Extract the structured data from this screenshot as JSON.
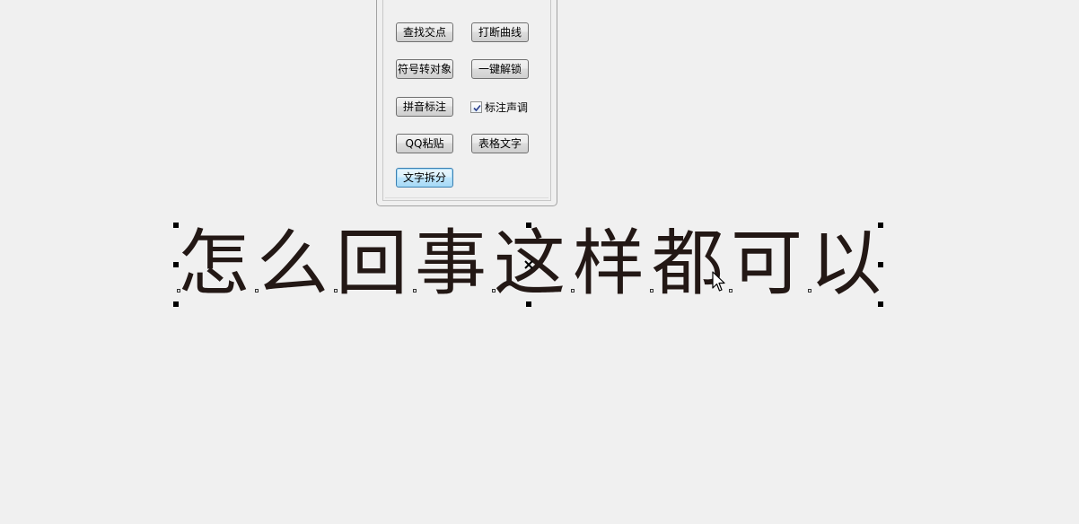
{
  "panel": {
    "buttons": {
      "find_intersection": "查找交点",
      "break_curve": "打断曲线",
      "symbol_to_object": "符号转对象",
      "one_click_unlock": "一键解锁",
      "pinyin_annotate": "拼音标注",
      "qq_paste": "QQ粘贴",
      "table_text": "表格文字",
      "text_split": "文字拆分"
    },
    "tone_checkbox": {
      "label": "标注声调",
      "checked": true
    }
  },
  "canvas": {
    "text": "怎么回事这样都可以",
    "text_color": "#231815"
  },
  "colors": {
    "background": "#f0f0f0",
    "focus_border": "#3c7fb1"
  }
}
